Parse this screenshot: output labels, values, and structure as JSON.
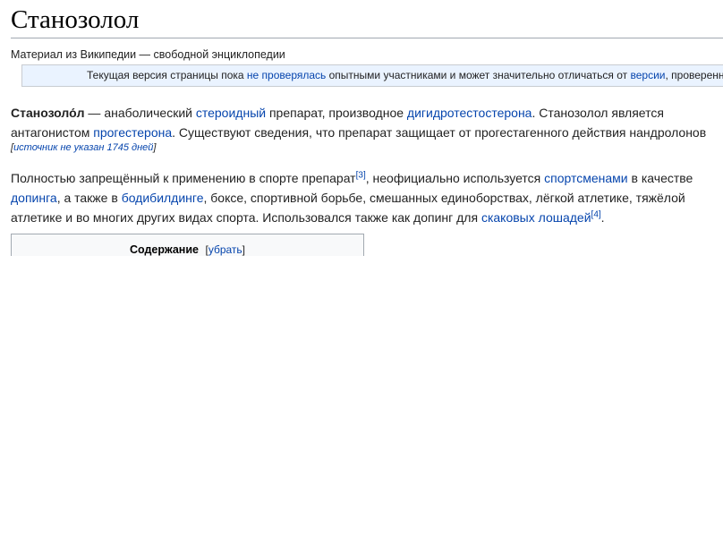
{
  "article": {
    "title": "Станозолол",
    "tagline": "Материал из Википедии — свободной энциклопедии"
  },
  "notice": {
    "text1": "Текущая версия страницы пока ",
    "link1": "не проверялась",
    "text2": " опытными участниками и может значительно отличаться от ",
    "link2": "версии",
    "text3": ", проверенной"
  },
  "paragraph1": {
    "bold_term": "Станозоло́л",
    "t1": " — анаболический ",
    "l1": "стероидный",
    "t2": " препарат, производное ",
    "l2": "дигидротестостерона",
    "t3": ". Станозолол является",
    "t4": "антагонистом ",
    "l3": "прогестерона",
    "t5": ". Существуют сведения, что препарат защищает от прогестагенного действия нандролонов",
    "citation_needed": {
      "open": "[",
      "link": "источник не указан 1745 дней",
      "close": "]"
    }
  },
  "paragraph2": {
    "t1": "Полностью запрещённый к применению в спорте препарат",
    "ref1": "[3]",
    "t2": ", неофициально используется ",
    "l1": "спортсменами",
    "t3": " в качестве",
    "l2": "допинга",
    "t4": ", а также в ",
    "l3": "бодибилдинге",
    "t5": ", боксе, спортивной борьбе, смешанных единоборствах, лёгкой атлетике, тяжёлой",
    "t6": "атлетике и во многих других видах спорта. Использовался также как допинг для ",
    "l4": "скаковых лошадей",
    "ref2": "[4]",
    "t7": "."
  },
  "toc": {
    "title": "Содержание",
    "toggle_open": "[",
    "toggle_link": "убрать",
    "toggle_close": "]"
  },
  "colors": {
    "link": "#0645ad",
    "notice_bg": "#eaf3ff",
    "rule": "#a2a9b1"
  }
}
